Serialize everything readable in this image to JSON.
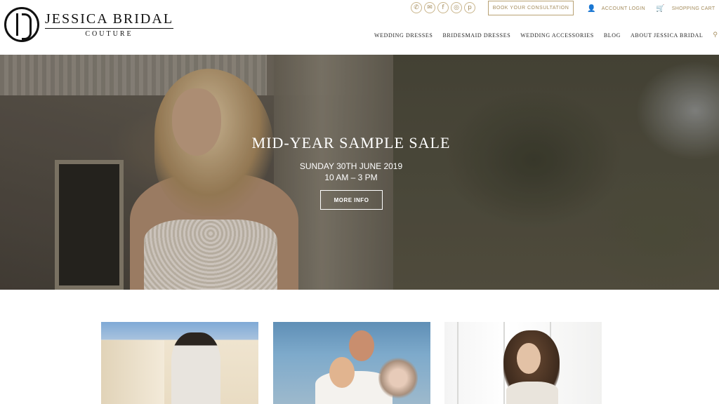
{
  "brand": {
    "title": "JESSICA BRIDAL",
    "subtitle": "COUTURE"
  },
  "header": {
    "social": [
      {
        "name": "phone-icon",
        "glyph": "✆"
      },
      {
        "name": "email-icon",
        "glyph": "✉"
      },
      {
        "name": "facebook-icon",
        "glyph": "f"
      },
      {
        "name": "instagram-icon",
        "glyph": "◎"
      },
      {
        "name": "pinterest-icon",
        "glyph": "p"
      }
    ],
    "consultation_label": "BOOK YOUR CONSULTATION",
    "account_label": "ACCOUNT LOGIN",
    "account_icon": "user-icon",
    "cart_label": "SHOPPING CART",
    "cart_icon": "cart-icon"
  },
  "nav": {
    "items": [
      "WEDDING DRESSES",
      "BRIDESMAID DRESSES",
      "WEDDING ACCESSORIES",
      "BLOG",
      "ABOUT JESSICA BRIDAL"
    ],
    "search_icon": "search-icon"
  },
  "hero": {
    "title": "MID-YEAR SAMPLE SALE",
    "date": "SUNDAY 30TH JUNE 2019",
    "time": "10 AM – 3 PM",
    "button_label": "MORE INFO"
  },
  "colors": {
    "accent": "#a48c5c",
    "text_dark": "#222222",
    "hero_text": "#ffffff"
  }
}
